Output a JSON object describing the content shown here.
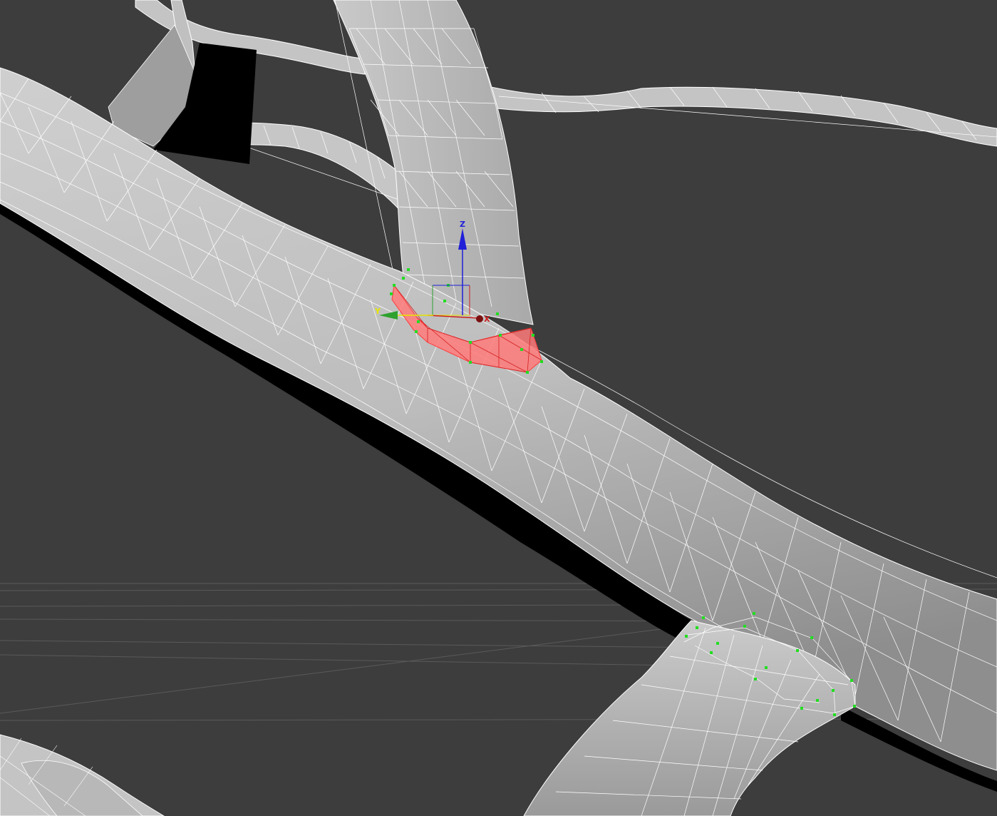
{
  "viewport": {
    "background": "#3d3d3d",
    "view": "perspective",
    "shading": "default-shading-with-edged-faces"
  },
  "gizmo": {
    "type": "move-transform-gizmo",
    "axes": {
      "x": {
        "label": "X",
        "color": "#cc1f1f"
      },
      "y": {
        "label": "Y",
        "color": "#2ea12e"
      },
      "z": {
        "label": "Z",
        "color": "#2020d8"
      }
    },
    "plane_handle_color": "#e6e600"
  },
  "selection": {
    "highlight_color": "#ff7a7a",
    "vertex_color": "#22dd22",
    "mode": "sub-object-polygon"
  },
  "materials": {
    "branch_fill": "#bdbdbd",
    "wire_color": "#ffffff",
    "shadow_color": "#000000"
  }
}
